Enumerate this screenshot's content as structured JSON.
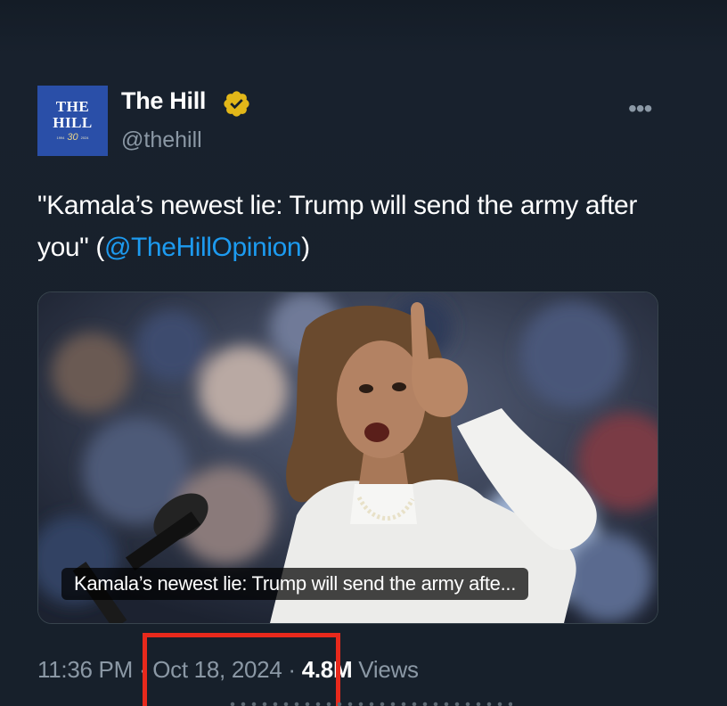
{
  "account": {
    "name": "The Hill",
    "handle": "@thehill",
    "verified_icon": "gold-verified-badge-icon",
    "avatar": {
      "line1": "THE",
      "line2": "HILL",
      "year_start": "1994",
      "anniversary": "30",
      "year_end": "2024"
    },
    "more_label": "•••"
  },
  "tweet": {
    "text_before": "\"Kamala’s newest lie: Trump will send the army after you\" (",
    "mention": "@TheHillOpinion",
    "text_after": ")"
  },
  "media": {
    "caption": "Kamala’s newest lie: Trump will send the army afte..."
  },
  "meta": {
    "time": "11:36 PM",
    "separator": "·",
    "date": "Oct 18, 2024",
    "views_count": "4.8M",
    "views_label": "Views"
  },
  "colors": {
    "background": "#15202b",
    "mention": "#1d9bf0",
    "muted": "#8b98a5",
    "highlight_box": "#e8291c",
    "avatar_bg": "#2a4fa8",
    "verified": "#e2b719"
  }
}
